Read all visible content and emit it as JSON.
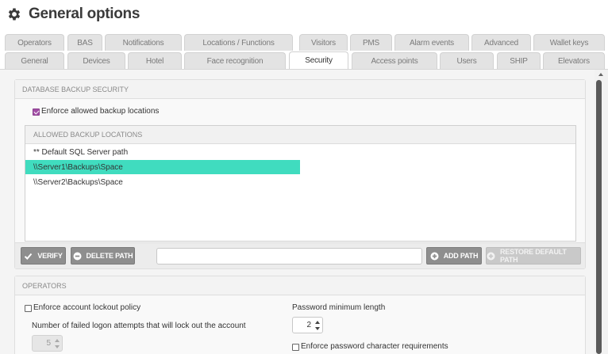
{
  "header": {
    "title": "General options",
    "icon": "gear-icon"
  },
  "tabs": {
    "row1": [
      "Operators",
      "BAS",
      "Notifications",
      "Locations / Functions",
      "Visitors",
      "PMS",
      "Alarm events",
      "Advanced",
      "Wallet keys"
    ],
    "row2": [
      "General",
      "Devices",
      "Hotel",
      "Face recognition",
      "Security",
      "Access points",
      "Users",
      "SHIP",
      "Elevators"
    ],
    "active": "Security"
  },
  "db_backup": {
    "header": "DATABASE BACKUP SECURITY",
    "enforce_label": "Enforce allowed backup locations",
    "enforce_checked": true,
    "locations_header": "ALLOWED BACKUP LOCATIONS",
    "locations": [
      "** Default SQL Server path",
      "\\\\Server1\\Backups\\Space",
      "\\\\Server2\\Backups\\Space"
    ],
    "selected_index": 1,
    "verify_label": "VERIFY",
    "delete_label": "DELETE PATH",
    "path_value": "",
    "add_label": "ADD PATH",
    "restore_label": "RESTORE DEFAULT PATH"
  },
  "operators": {
    "header": "OPERATORS",
    "lockout_label": "Enforce account lockout policy",
    "lockout_checked": false,
    "failed_attempts_label": "Number of failed logon attempts that will lock out the account",
    "failed_attempts_value": "5",
    "min_length_label": "Password minimum length",
    "min_length_value": "2",
    "char_req_label": "Enforce password character requirements",
    "char_req_checked": false
  },
  "colors": {
    "accent": "#40dcbf",
    "checkbox": "#a24ea6",
    "button": "#8e8e8e"
  }
}
